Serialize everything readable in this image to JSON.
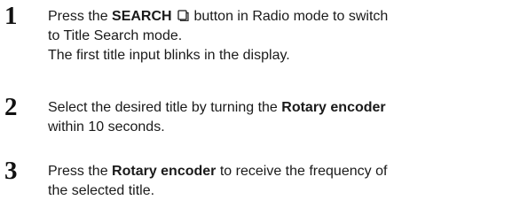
{
  "steps": [
    {
      "number": "1",
      "line1_pre": "Press the ",
      "line1_bold": "SEARCH",
      "line1_icon": "search-page-icon",
      "line1_post": " button in Radio mode to switch",
      "line2": "to Title Search mode.",
      "line3": "The first title input blinks in the display."
    },
    {
      "number": "2",
      "line1_pre": "Select the desired title by turning the ",
      "line1_bold": "Rotary encoder",
      "line2": "within 10 seconds."
    },
    {
      "number": "3",
      "line1_pre": "Press the ",
      "line1_bold": "Rotary encoder",
      "line1_post": " to receive the frequency of",
      "line2": "the selected title."
    }
  ]
}
